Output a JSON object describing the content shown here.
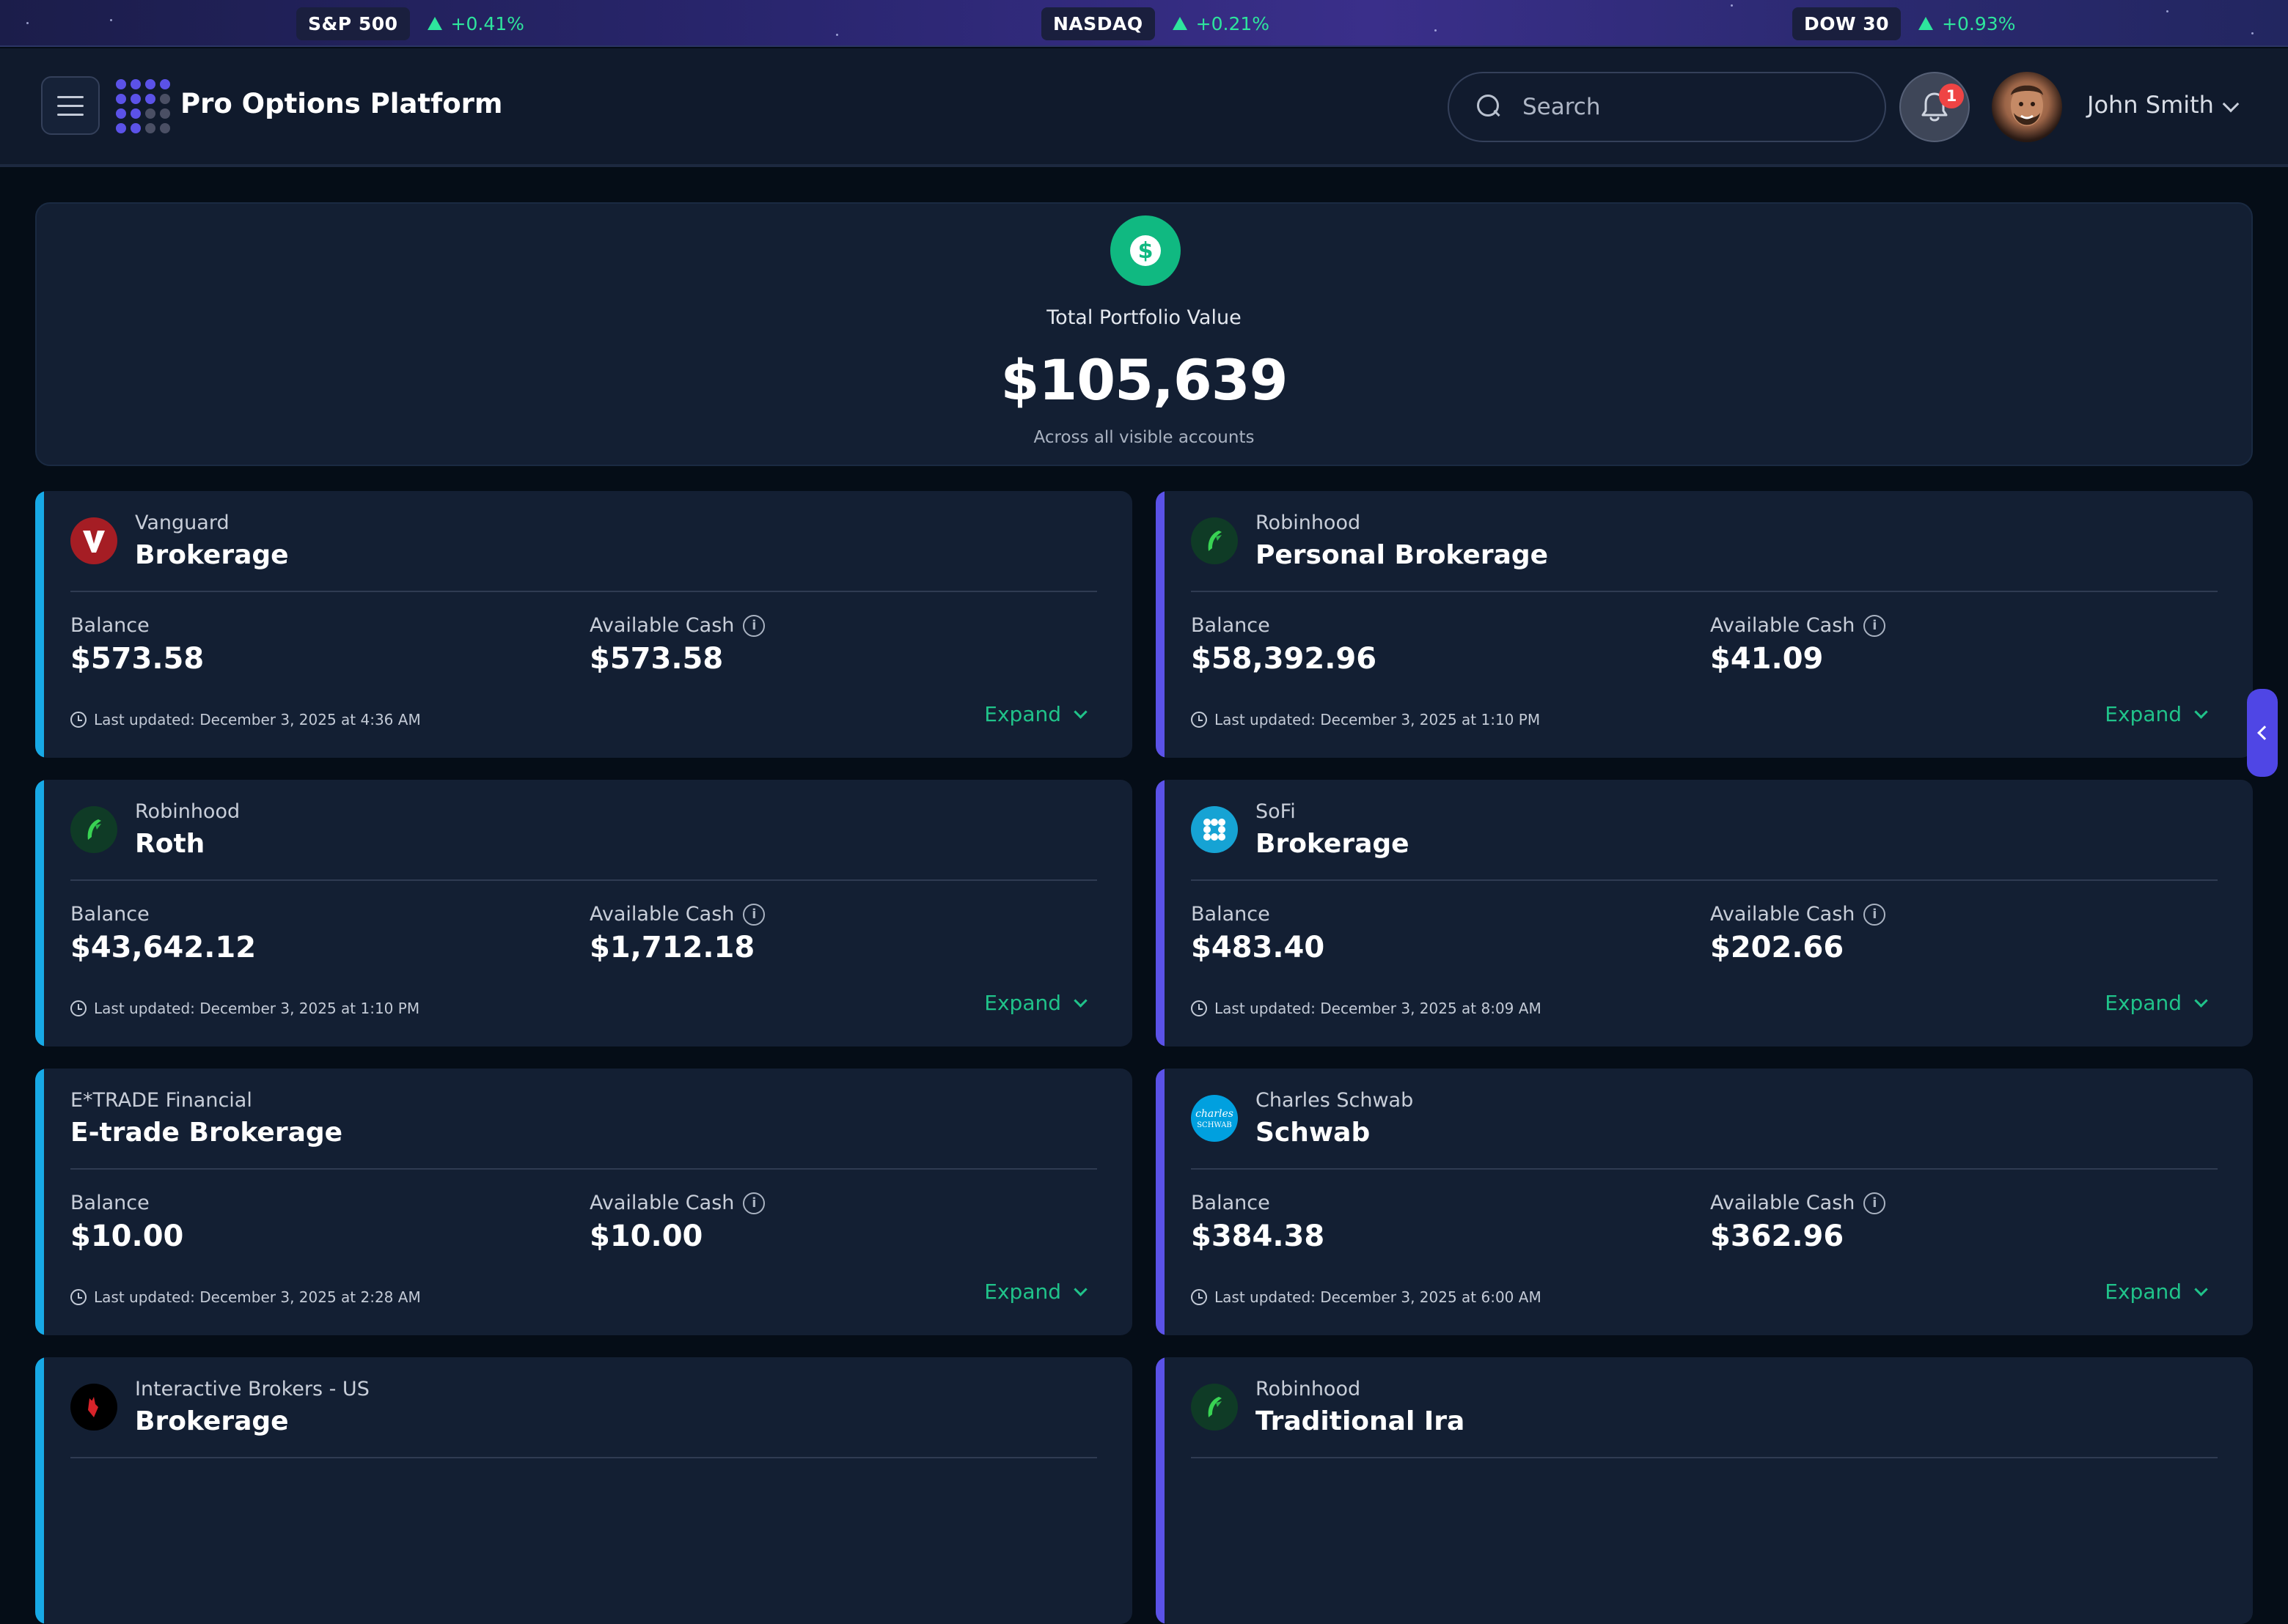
{
  "ticker": [
    {
      "label": "S&P 500",
      "change": "+0.41%"
    },
    {
      "label": "NASDAQ",
      "change": "+0.21%"
    },
    {
      "label": "DOW 30",
      "change": "+0.93%"
    }
  ],
  "header": {
    "brand": "Pro Options Platform",
    "search_placeholder": "Search",
    "notification_count": "1",
    "user_name": "John Smith"
  },
  "summary": {
    "label": "Total Portfolio Value",
    "value": "$105,639",
    "sub": "Across all visible accounts",
    "icon": "dollar-icon"
  },
  "labels": {
    "balance": "Balance",
    "available_cash": "Available Cash",
    "expand": "Expand"
  },
  "colors": {
    "accent_cyan": "#17a9e6",
    "accent_indigo": "#5b52e8",
    "positive": "#2ee59d",
    "expand_green": "#20c38a"
  },
  "accounts": [
    {
      "broker": "Vanguard",
      "name": "Brokerage",
      "balance": "$573.58",
      "cash": "$573.58",
      "updated": "Last updated: December 3, 2025 at 4:36 AM",
      "logo": "vanguard-logo"
    },
    {
      "broker": "Robinhood",
      "name": "Personal Brokerage",
      "balance": "$58,392.96",
      "cash": "$41.09",
      "updated": "Last updated: December 3, 2025 at 1:10 PM",
      "logo": "robinhood-logo"
    },
    {
      "broker": "Robinhood",
      "name": "Roth",
      "balance": "$43,642.12",
      "cash": "$1,712.18",
      "updated": "Last updated: December 3, 2025 at 1:10 PM",
      "logo": "robinhood-logo"
    },
    {
      "broker": "SoFi",
      "name": "Brokerage",
      "balance": "$483.40",
      "cash": "$202.66",
      "updated": "Last updated: December 3, 2025 at 8:09 AM",
      "logo": "sofi-logo"
    },
    {
      "broker": "E*TRADE Financial",
      "name": "E-trade Brokerage",
      "balance": "$10.00",
      "cash": "$10.00",
      "updated": "Last updated: December 3, 2025 at 2:28 AM",
      "logo": ""
    },
    {
      "broker": "Charles Schwab",
      "name": "Schwab",
      "balance": "$384.38",
      "cash": "$362.96",
      "updated": "Last updated: December 3, 2025 at 6:00 AM",
      "logo": "schwab-logo",
      "logo_text": "charles SCHWAB"
    },
    {
      "broker": "Interactive Brokers - US",
      "name": "Brokerage",
      "logo": "ibkr-logo"
    },
    {
      "broker": "Robinhood",
      "name": "Traditional Ira",
      "logo": "robinhood-logo"
    }
  ]
}
